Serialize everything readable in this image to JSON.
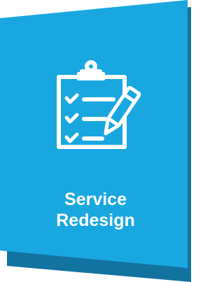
{
  "card": {
    "title_line1": "Service",
    "title_line2": "Redesign",
    "icon": "clipboard-checklist-pencil-icon",
    "colors": {
      "face": "#19a7e0",
      "shadow": "#1273a0",
      "icon": "#ffffff",
      "text": "#ffffff"
    }
  }
}
